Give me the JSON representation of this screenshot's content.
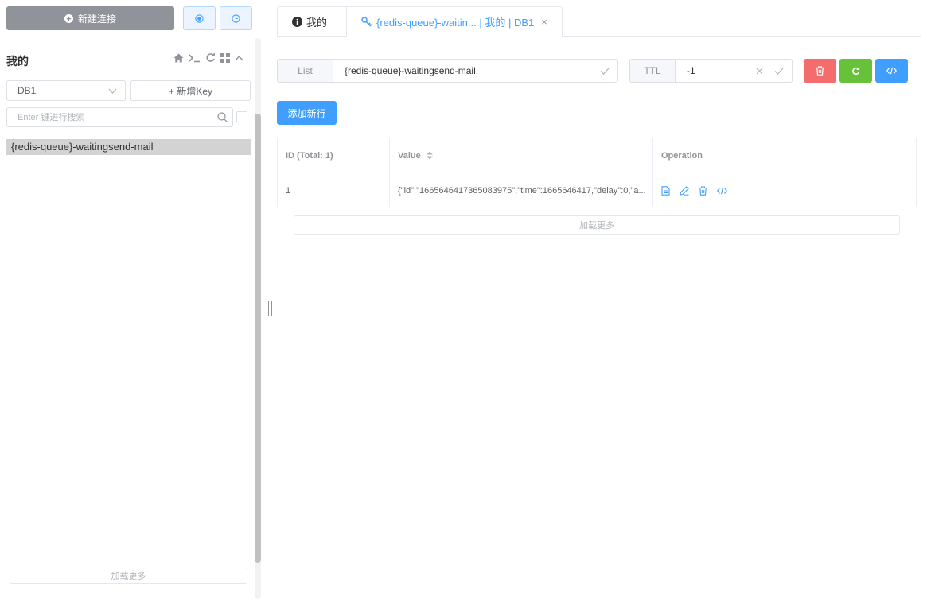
{
  "sidebar": {
    "new_connection_label": "新建连接",
    "connection_name": "我的",
    "db_select_value": "DB1",
    "add_key_label": "+ 新增Key",
    "search_placeholder": "Enter 键进行搜索",
    "keys": [
      "{redis-queue}-waitingsend-mail"
    ],
    "load_more_label": "加载更多"
  },
  "tabs": [
    {
      "label": "我的",
      "icon": "info-circle-icon"
    },
    {
      "label": "{redis-queue}-waitin... | 我的 | DB1",
      "icon": "key-icon",
      "active": true
    }
  ],
  "key_header": {
    "type_label": "List",
    "key_name": "{redis-queue}-waitingsend-mail",
    "ttl_label": "TTL",
    "ttl_value": "-1"
  },
  "add_row_label": "添加新行",
  "table": {
    "headers": [
      "ID (Total: 1)",
      "Value",
      "Operation"
    ],
    "rows": [
      {
        "id": "1",
        "value": "{\"id\":\"1665646417365083975\",\"time\":1665646417,\"delay\":0,\"a..."
      }
    ]
  },
  "load_more_label": "加载更多",
  "colors": {
    "primary": "#409eff",
    "danger": "#f56c6c",
    "success": "#67c23a",
    "info": "#909399"
  }
}
